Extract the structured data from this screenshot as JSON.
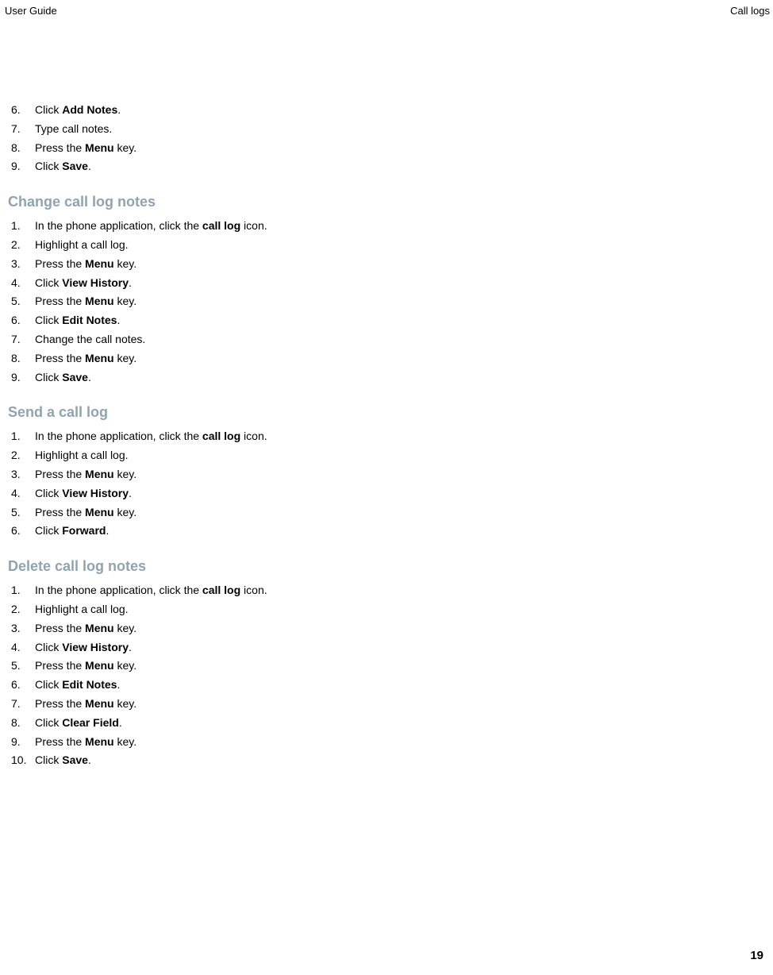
{
  "header": {
    "left": "User Guide",
    "right": "Call logs"
  },
  "intro": {
    "items": [
      {
        "n": "6.",
        "parts": [
          {
            "t": "Click "
          },
          {
            "t": "Add Notes",
            "b": true
          },
          {
            "t": "."
          }
        ]
      },
      {
        "n": "7.",
        "parts": [
          {
            "t": "Type call notes."
          }
        ]
      },
      {
        "n": "8.",
        "parts": [
          {
            "t": "Press the "
          },
          {
            "t": "Menu",
            "b": true
          },
          {
            "t": " key."
          }
        ]
      },
      {
        "n": "9.",
        "parts": [
          {
            "t": "Click "
          },
          {
            "t": "Save",
            "b": true
          },
          {
            "t": "."
          }
        ]
      }
    ]
  },
  "sections": [
    {
      "title": "Change call log notes",
      "items": [
        {
          "n": "1.",
          "parts": [
            {
              "t": "In the phone application, click the "
            },
            {
              "t": "call log",
              "b": true
            },
            {
              "t": " icon."
            }
          ]
        },
        {
          "n": "2.",
          "parts": [
            {
              "t": "Highlight a call log."
            }
          ]
        },
        {
          "n": "3.",
          "parts": [
            {
              "t": "Press the "
            },
            {
              "t": "Menu",
              "b": true
            },
            {
              "t": " key."
            }
          ]
        },
        {
          "n": "4.",
          "parts": [
            {
              "t": "Click "
            },
            {
              "t": "View History",
              "b": true
            },
            {
              "t": "."
            }
          ]
        },
        {
          "n": "5.",
          "parts": [
            {
              "t": "Press the "
            },
            {
              "t": "Menu",
              "b": true
            },
            {
              "t": " key."
            }
          ]
        },
        {
          "n": "6.",
          "parts": [
            {
              "t": "Click "
            },
            {
              "t": "Edit Notes",
              "b": true
            },
            {
              "t": "."
            }
          ]
        },
        {
          "n": "7.",
          "parts": [
            {
              "t": "Change the call notes."
            }
          ]
        },
        {
          "n": "8.",
          "parts": [
            {
              "t": "Press the "
            },
            {
              "t": "Menu",
              "b": true
            },
            {
              "t": " key."
            }
          ]
        },
        {
          "n": "9.",
          "parts": [
            {
              "t": "Click "
            },
            {
              "t": "Save",
              "b": true
            },
            {
              "t": "."
            }
          ]
        }
      ]
    },
    {
      "title": "Send a call log",
      "items": [
        {
          "n": "1.",
          "parts": [
            {
              "t": "In the phone application, click the "
            },
            {
              "t": "call log",
              "b": true
            },
            {
              "t": " icon."
            }
          ]
        },
        {
          "n": "2.",
          "parts": [
            {
              "t": "Highlight a call log."
            }
          ]
        },
        {
          "n": "3.",
          "parts": [
            {
              "t": "Press the "
            },
            {
              "t": "Menu",
              "b": true
            },
            {
              "t": " key."
            }
          ]
        },
        {
          "n": "4.",
          "parts": [
            {
              "t": "Click "
            },
            {
              "t": "View History",
              "b": true
            },
            {
              "t": "."
            }
          ]
        },
        {
          "n": "5.",
          "parts": [
            {
              "t": "Press the "
            },
            {
              "t": "Menu",
              "b": true
            },
            {
              "t": " key."
            }
          ]
        },
        {
          "n": "6.",
          "parts": [
            {
              "t": "Click "
            },
            {
              "t": "Forward",
              "b": true
            },
            {
              "t": "."
            }
          ]
        }
      ]
    },
    {
      "title": "Delete call log notes",
      "items": [
        {
          "n": "1.",
          "parts": [
            {
              "t": "In the phone application, click the "
            },
            {
              "t": "call log",
              "b": true
            },
            {
              "t": " icon."
            }
          ]
        },
        {
          "n": "2.",
          "parts": [
            {
              "t": "Highlight a call log."
            }
          ]
        },
        {
          "n": "3.",
          "parts": [
            {
              "t": "Press the "
            },
            {
              "t": "Menu",
              "b": true
            },
            {
              "t": " key."
            }
          ]
        },
        {
          "n": "4.",
          "parts": [
            {
              "t": "Click "
            },
            {
              "t": "View History",
              "b": true
            },
            {
              "t": "."
            }
          ]
        },
        {
          "n": "5.",
          "parts": [
            {
              "t": "Press the "
            },
            {
              "t": "Menu",
              "b": true
            },
            {
              "t": " key."
            }
          ]
        },
        {
          "n": "6.",
          "parts": [
            {
              "t": "Click "
            },
            {
              "t": "Edit Notes",
              "b": true
            },
            {
              "t": "."
            }
          ]
        },
        {
          "n": "7.",
          "parts": [
            {
              "t": "Press the "
            },
            {
              "t": "Menu",
              "b": true
            },
            {
              "t": " key."
            }
          ]
        },
        {
          "n": "8.",
          "parts": [
            {
              "t": "Click "
            },
            {
              "t": "Clear Field",
              "b": true
            },
            {
              "t": "."
            }
          ]
        },
        {
          "n": "9.",
          "parts": [
            {
              "t": "Press the "
            },
            {
              "t": "Menu",
              "b": true
            },
            {
              "t": " key."
            }
          ]
        },
        {
          "n": "10.",
          "parts": [
            {
              "t": "Click "
            },
            {
              "t": "Save",
              "b": true
            },
            {
              "t": "."
            }
          ]
        }
      ]
    }
  ],
  "pageNumber": "19"
}
